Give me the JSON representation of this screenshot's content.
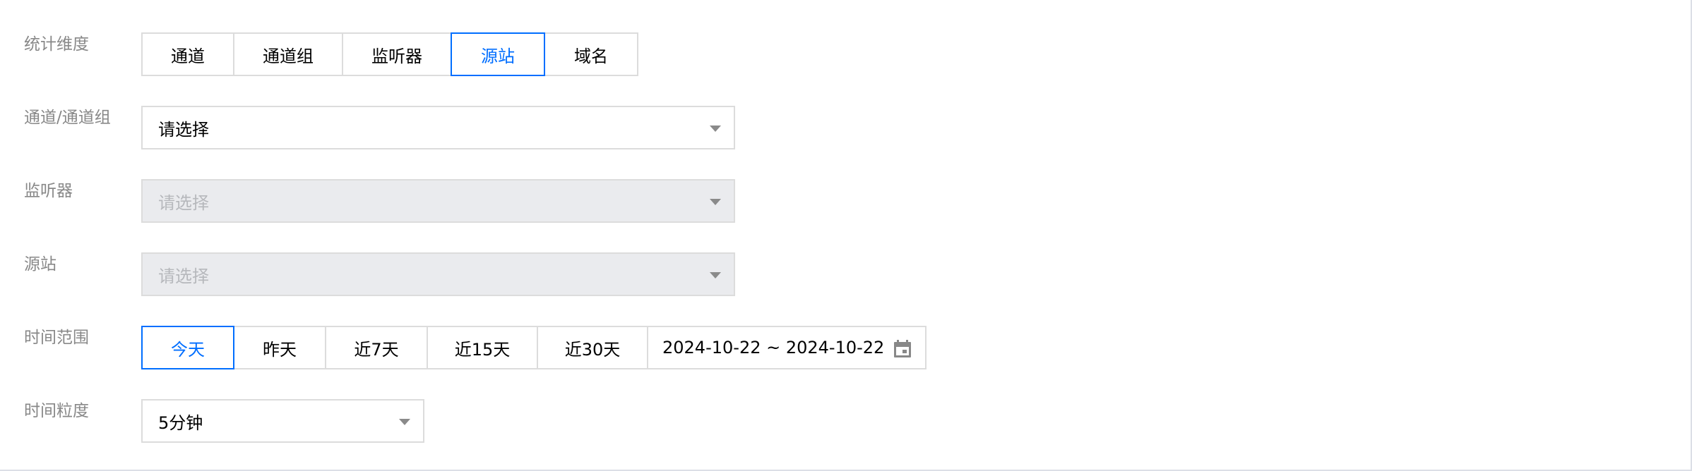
{
  "filters": {
    "dimension": {
      "label": "统计维度",
      "options": [
        "通道",
        "通道组",
        "监听器",
        "源站",
        "域名"
      ],
      "selected": "源站"
    },
    "channel": {
      "label": "通道/通道组",
      "value": "请选择",
      "disabled": false
    },
    "listener": {
      "label": "监听器",
      "value": "请选择",
      "disabled": true
    },
    "origin": {
      "label": "源站",
      "value": "请选择",
      "disabled": true
    },
    "time_range": {
      "label": "时间范围",
      "options": [
        "今天",
        "昨天",
        "近7天",
        "近15天",
        "近30天"
      ],
      "selected": "今天",
      "date_range": "2024-10-22 ~ 2024-10-22",
      "icon": "calendar-icon"
    },
    "granularity": {
      "label": "时间粒度",
      "value": "5分钟"
    }
  },
  "colors": {
    "accent": "#006eff",
    "border": "#dcdcdc",
    "label": "#888888",
    "disabled_bg": "#eaebee",
    "disabled_text": "#b6b8bc"
  }
}
